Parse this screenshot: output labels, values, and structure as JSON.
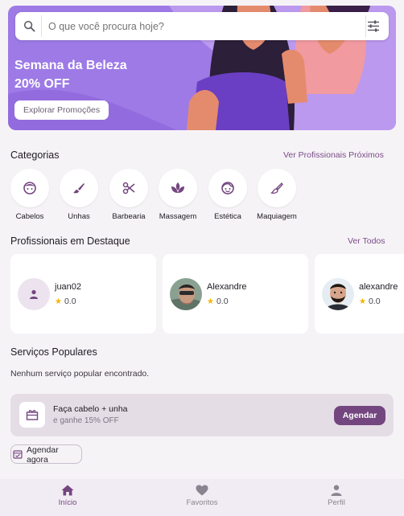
{
  "search": {
    "placeholder": "O que você procura hoje?",
    "icon": "search-icon",
    "filter_icon": "tune-icon"
  },
  "hero": {
    "title_line1": "Semana da Beleza",
    "title_line2": "20% OFF",
    "button_label": "Explorar Promoções",
    "bg_color": "#9d7ae6"
  },
  "categories": {
    "title": "Categorias",
    "link": "Ver Profissionais Próximos",
    "items": [
      {
        "label": "Cabelos",
        "icon": "face-hair-icon"
      },
      {
        "label": "Unhas",
        "icon": "brush-icon"
      },
      {
        "label": "Barbearia",
        "icon": "scissors-icon"
      },
      {
        "label": "Massagem",
        "icon": "spa-icon"
      },
      {
        "label": "Estética",
        "icon": "face-icon"
      },
      {
        "label": "Maquiagem",
        "icon": "makeup-brush-icon"
      }
    ]
  },
  "professionals": {
    "title": "Profissionais em Destaque",
    "link": "Ver Todos",
    "items": [
      {
        "name": "juan02",
        "rating": "0.0",
        "avatar": "person-placeholder"
      },
      {
        "name": "Alexandre",
        "rating": "0.0",
        "avatar": "photo"
      },
      {
        "name": "alexandre",
        "rating": "0.0",
        "avatar": "photo"
      }
    ]
  },
  "popular": {
    "title": "Serviços Populares",
    "empty": "Nenhum serviço popular encontrado."
  },
  "promo": {
    "title": "Faça cabelo + unha",
    "subtitle": "e ganhe 15% OFF",
    "button": "Agendar",
    "icon": "gift-icon",
    "accent": "#74467f"
  },
  "schedule_button": "Agendar agora",
  "nav": [
    {
      "label": "Início",
      "icon": "home-icon",
      "active": true
    },
    {
      "label": "Favoritos",
      "icon": "heart-icon",
      "active": false
    },
    {
      "label": "Perfil",
      "icon": "person-icon",
      "active": false
    }
  ]
}
